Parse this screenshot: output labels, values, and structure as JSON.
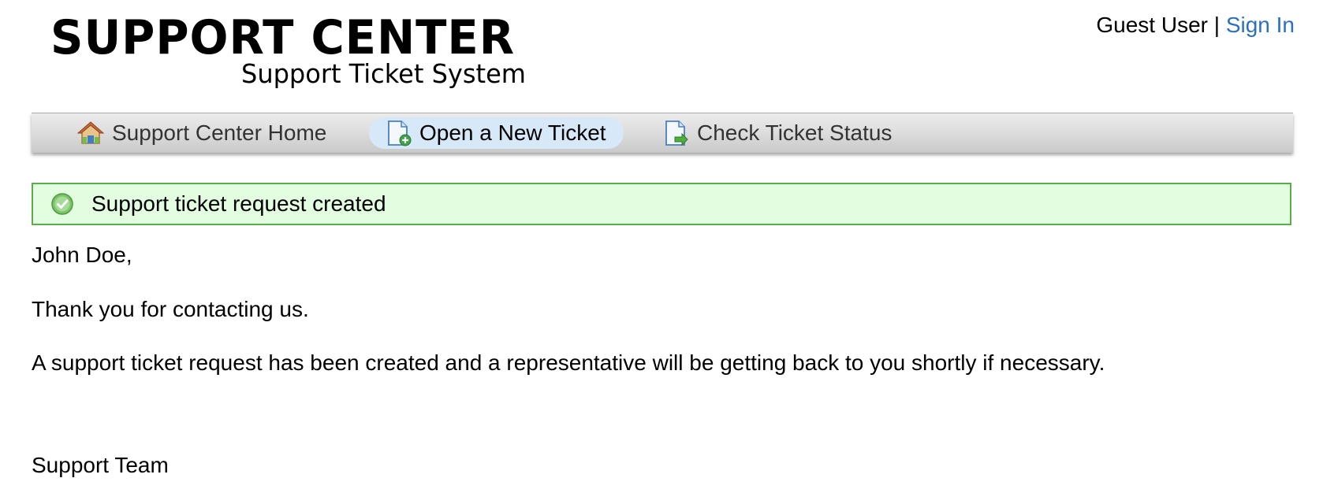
{
  "header": {
    "logo_title": "SUPPORT CENTER",
    "logo_subtitle": "Support Ticket System",
    "user_name": "Guest User",
    "separator": "|",
    "sign_in_label": "Sign In"
  },
  "nav": {
    "items": [
      {
        "label": "Support Center Home",
        "icon": "home-icon"
      },
      {
        "label": "Open a New Ticket",
        "icon": "new-ticket-icon",
        "active": true
      },
      {
        "label": "Check Ticket Status",
        "icon": "ticket-status-icon"
      }
    ]
  },
  "notice": {
    "text": "Support ticket request created",
    "icon": "success-check-icon"
  },
  "message": {
    "greeting": "John Doe,",
    "thanks": "Thank you for contacting us.",
    "body": "A support ticket request has been created and a representative will be getting back to you shortly if necessary.",
    "signature": "Support Team"
  },
  "colors": {
    "link": "#2a6fc0",
    "notice_bg": "#e2fde0",
    "notice_border": "#5aad4a",
    "active_tab_bg": "#d7e8f8"
  }
}
